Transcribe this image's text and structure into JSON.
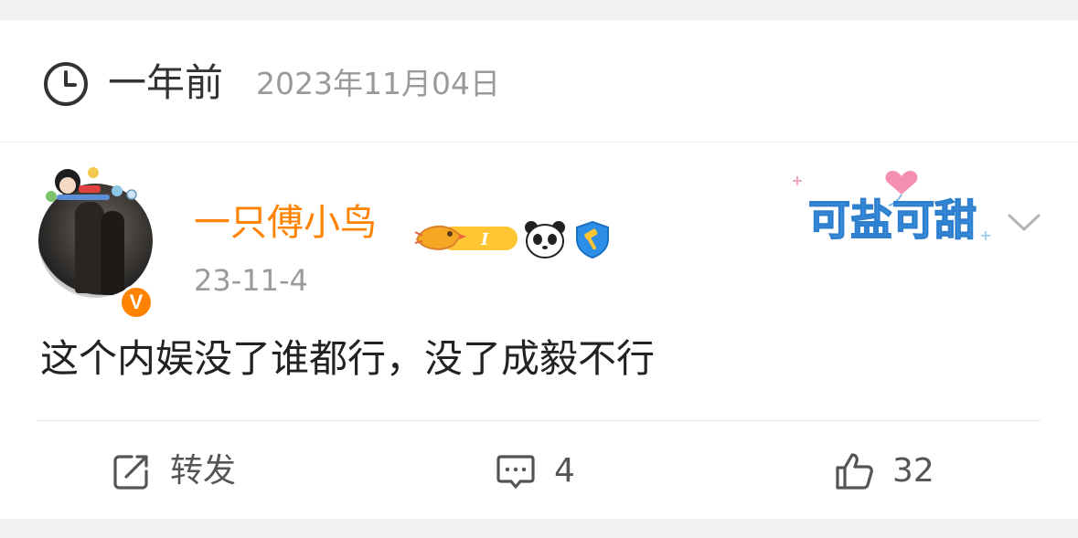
{
  "header": {
    "time_ago": "一年前",
    "date": "2023年11月04日"
  },
  "post": {
    "author": {
      "name": "一只傅小鸟",
      "verified_badge": "V",
      "level_badge_text": "I",
      "badges": [
        "bird-level-badge-icon",
        "panda-icon",
        "shield-hammer-icon"
      ]
    },
    "date": "23-11-4",
    "sticker_text": "可盐可甜",
    "text": "这个内娱没了谁都行，没了成毅不行"
  },
  "actions": {
    "repost_label": "转发",
    "comment_count": "4",
    "like_count": "32"
  },
  "colors": {
    "accent": "#ff8200",
    "text": "#222222",
    "muted": "#9a9a9a",
    "background": "#f2f2f4"
  }
}
